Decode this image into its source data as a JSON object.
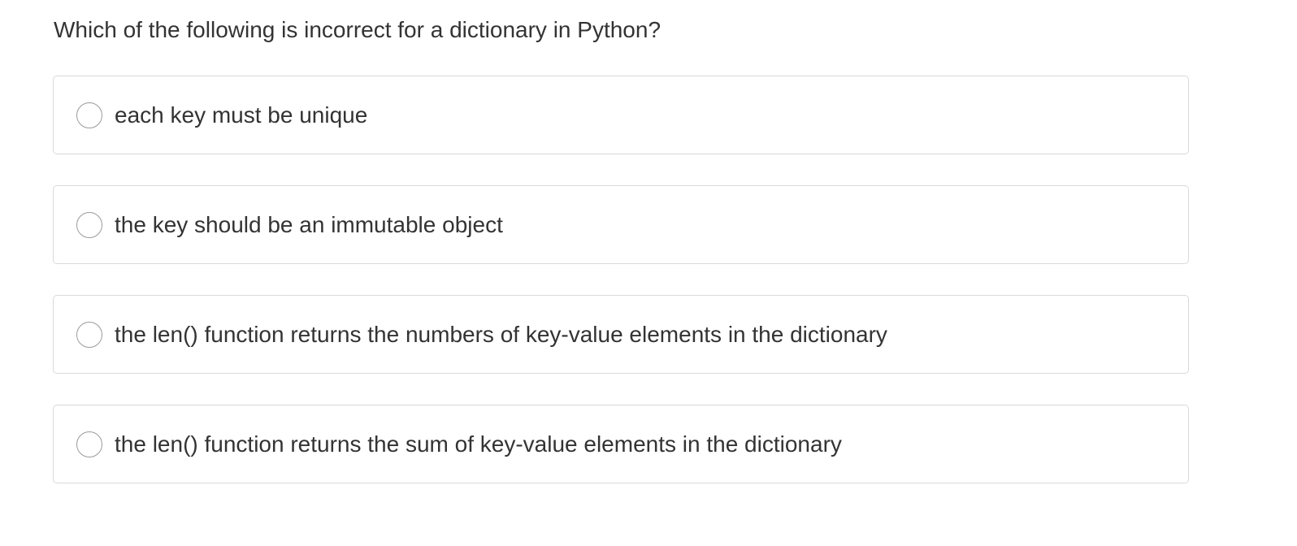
{
  "quiz": {
    "question": "Which of the following is incorrect for a dictionary in Python?",
    "options": [
      {
        "label": "each key must be unique",
        "selected": false
      },
      {
        "label": "the key should be an immutable object",
        "selected": false
      },
      {
        "label": "the len() function returns the numbers of key-value elements in the dictionary",
        "selected": false
      },
      {
        "label": "the len() function returns the sum of key-value elements in the dictionary",
        "selected": false
      }
    ]
  },
  "colors": {
    "text": "#333333",
    "border": "#d9d9d9",
    "radio_border": "#9a9a9a",
    "background": "#ffffff"
  },
  "icons": {
    "option_marker": "radio-button-icon"
  }
}
